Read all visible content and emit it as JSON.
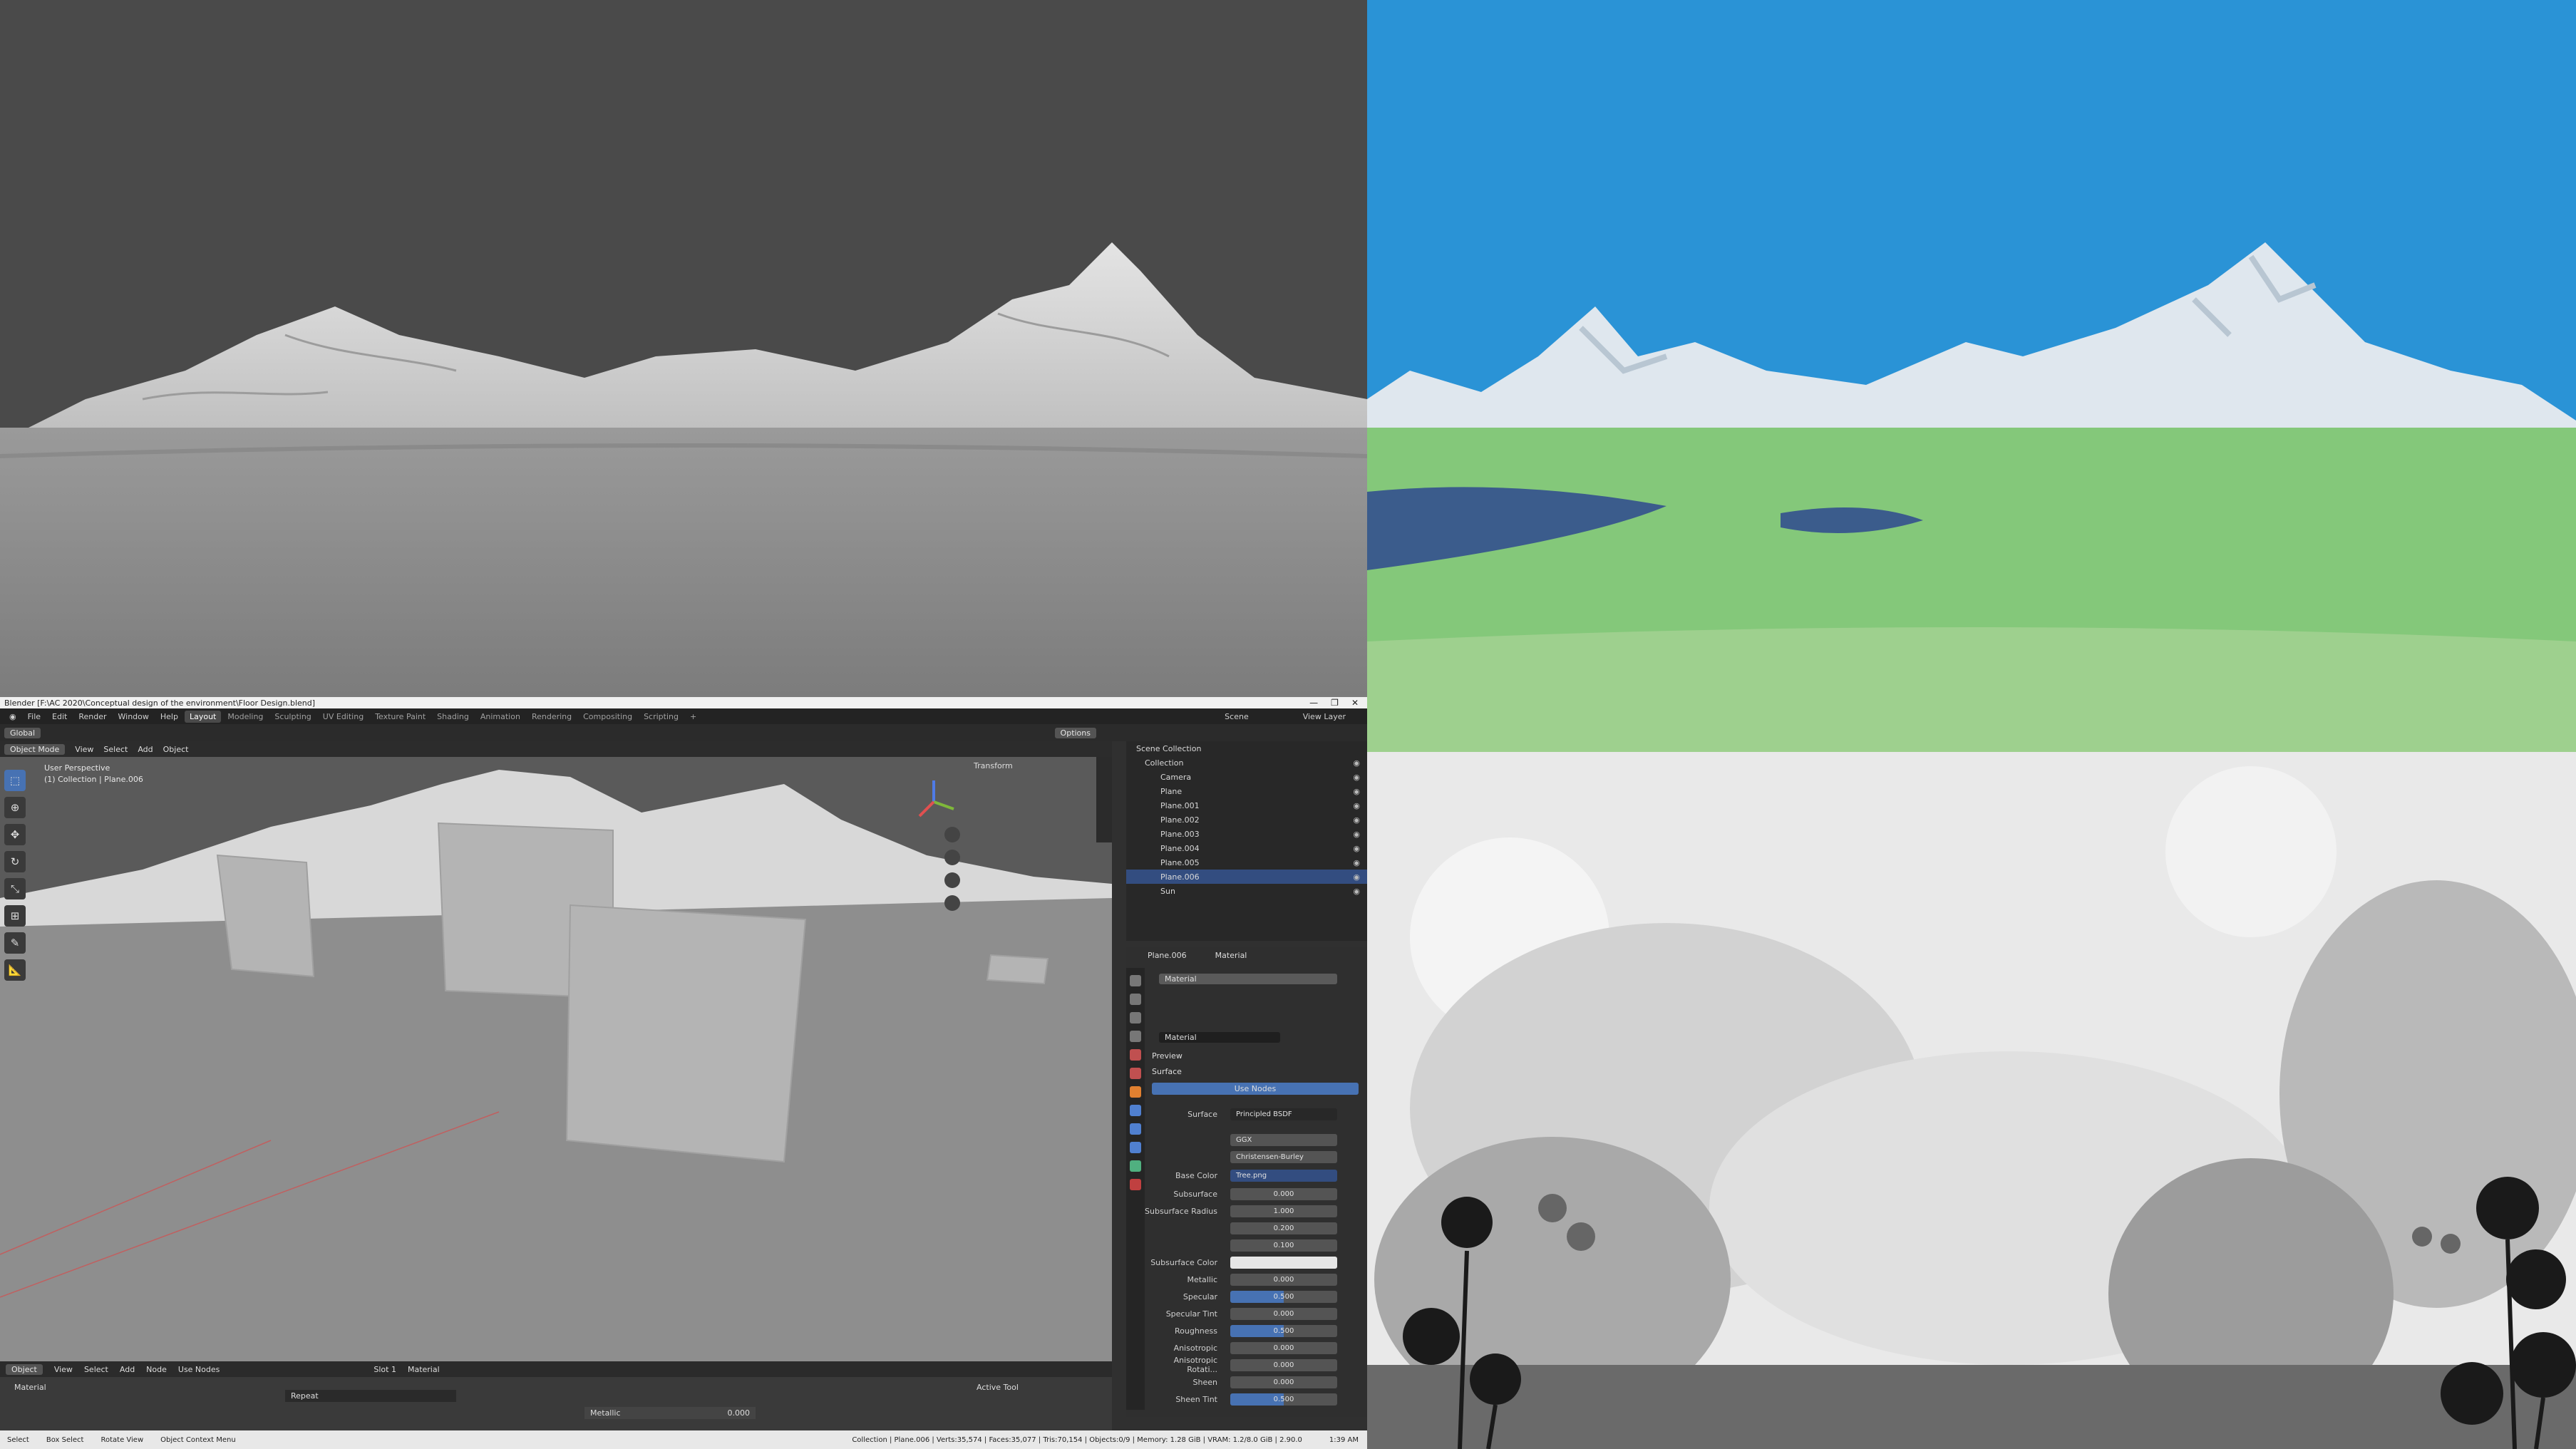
{
  "window": {
    "title": "Blender [F:\\AC 2020\\Conceptual design of the environment\\Floor Design.blend]",
    "controls": [
      "—",
      "❐",
      "✕"
    ]
  },
  "menu": [
    "File",
    "Edit",
    "Render",
    "Window",
    "Help"
  ],
  "workspaces": [
    "Layout",
    "Modeling",
    "Sculpting",
    "UV Editing",
    "Texture Paint",
    "Shading",
    "Animation",
    "Rendering",
    "Compositing",
    "Scripting",
    "+"
  ],
  "scene": {
    "label": "Scene",
    "view_layer": "View Layer"
  },
  "tool_header": {
    "transform": "Global",
    "options": "Options"
  },
  "viewport": {
    "mode": "Object Mode",
    "menus": [
      "View",
      "Select",
      "Add",
      "Object"
    ],
    "perspective": "User Perspective",
    "collection": "(1) Collection | Plane.006",
    "transform_label": "Transform"
  },
  "outliner": {
    "root": "Scene Collection",
    "collection": "Collection",
    "items": [
      "Camera",
      "Plane",
      "Plane.001",
      "Plane.002",
      "Plane.003",
      "Plane.004",
      "Plane.005",
      "Plane.006",
      "Sun"
    ]
  },
  "properties": {
    "object": "Plane.006",
    "material_tab": "Material",
    "slot_name": "Material",
    "material_name": "Material",
    "sections": [
      "Preview",
      "Surface"
    ],
    "use_nodes": "Use Nodes",
    "surface": {
      "label": "Surface",
      "value": "Principled BSDF"
    },
    "distribution": "GGX",
    "subsurface_method": "Christensen-Burley",
    "base_color": {
      "label": "Base Color",
      "value": "Tree.png"
    },
    "fields": [
      {
        "label": "Subsurface",
        "value": "0.000"
      },
      {
        "label": "Subsurface Radius",
        "value": "1.000"
      },
      {
        "label": "",
        "value": "0.200"
      },
      {
        "label": "",
        "value": "0.100"
      },
      {
        "label": "Subsurface Color",
        "value": ""
      },
      {
        "label": "Metallic",
        "value": "0.000"
      },
      {
        "label": "Specular",
        "value": "0.500"
      },
      {
        "label": "Specular Tint",
        "value": "0.000"
      },
      {
        "label": "Roughness",
        "value": "0.500"
      },
      {
        "label": "Anisotropic",
        "value": "0.000"
      },
      {
        "label": "Anisotropic Rotati...",
        "value": "0.000"
      },
      {
        "label": "Sheen",
        "value": "0.000"
      },
      {
        "label": "Sheen Tint",
        "value": "0.500"
      }
    ]
  },
  "node_editor": {
    "mode": "Object",
    "menus": [
      "View",
      "Select",
      "Add",
      "Node"
    ],
    "use_nodes": "Use Nodes",
    "slot": "Slot 1",
    "material": "Material",
    "label": "Material",
    "extension": "Repeat",
    "metallic_label": "Metallic",
    "metallic_value": "0.000",
    "active_tool": "Active Tool"
  },
  "statusbar": {
    "items": [
      "Select",
      "Box Select",
      "Rotate View",
      "Object Context Menu"
    ],
    "stats": "Collection | Plane.006 | Verts:35,574 | Faces:35,077 | Tris:70,154 | Objects:0/9 | Memory: 1.28 GiB | VRAM: 1.2/8.0 GiB | 2.90.0",
    "clock": "1:39 AM"
  },
  "colors": {
    "accent": "#4772b3",
    "sky": "#2a93d6",
    "grass": "#84c87a"
  }
}
